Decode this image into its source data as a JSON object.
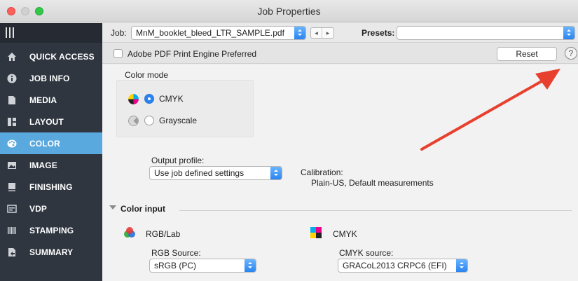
{
  "window": {
    "title": "Job Properties"
  },
  "sidebar": {
    "items": [
      {
        "label": "QUICK ACCESS",
        "icon": "home-icon"
      },
      {
        "label": "JOB INFO",
        "icon": "info-icon"
      },
      {
        "label": "MEDIA",
        "icon": "page-icon"
      },
      {
        "label": "LAYOUT",
        "icon": "layout-icon"
      },
      {
        "label": "COLOR",
        "icon": "palette-icon",
        "active": true
      },
      {
        "label": "IMAGE",
        "icon": "image-icon"
      },
      {
        "label": "FINISHING",
        "icon": "finishing-icon"
      },
      {
        "label": "VDP",
        "icon": "vdp-icon"
      },
      {
        "label": "STAMPING",
        "icon": "barcode-icon"
      },
      {
        "label": "SUMMARY",
        "icon": "summary-icon"
      }
    ],
    "active_color": "#5aa9de"
  },
  "toolbar": {
    "job_label": "Job:",
    "job_value": "MnM_booklet_bleed_LTR_SAMPLE.pdf",
    "nav_prev": "◂",
    "nav_next": "▸",
    "presets_label": "Presets:",
    "presets_value": ""
  },
  "bar2": {
    "checkbox_label": "Adobe PDF Print Engine Preferred",
    "reset_label": "Reset",
    "help_label": "?"
  },
  "color_mode": {
    "title": "Color mode",
    "options": [
      {
        "label": "CMYK",
        "selected": true
      },
      {
        "label": "Grayscale",
        "selected": false
      }
    ]
  },
  "output_profile": {
    "label": "Output profile:",
    "value": "Use job defined settings"
  },
  "calibration": {
    "label": "Calibration:",
    "value": "Plain-US, Default measurements"
  },
  "color_input": {
    "title": "Color input",
    "rgb": {
      "title": "RGB/Lab",
      "source_label": "RGB Source:",
      "source_value": "sRGB (PC)"
    },
    "cmyk": {
      "title": "CMYK",
      "source_label": "CMYK source:",
      "source_value": "GRACoL2013 CRPC6 (EFI)"
    }
  },
  "colors": {
    "accent": "#2a84f0",
    "annotation_arrow": "#e8402f"
  }
}
